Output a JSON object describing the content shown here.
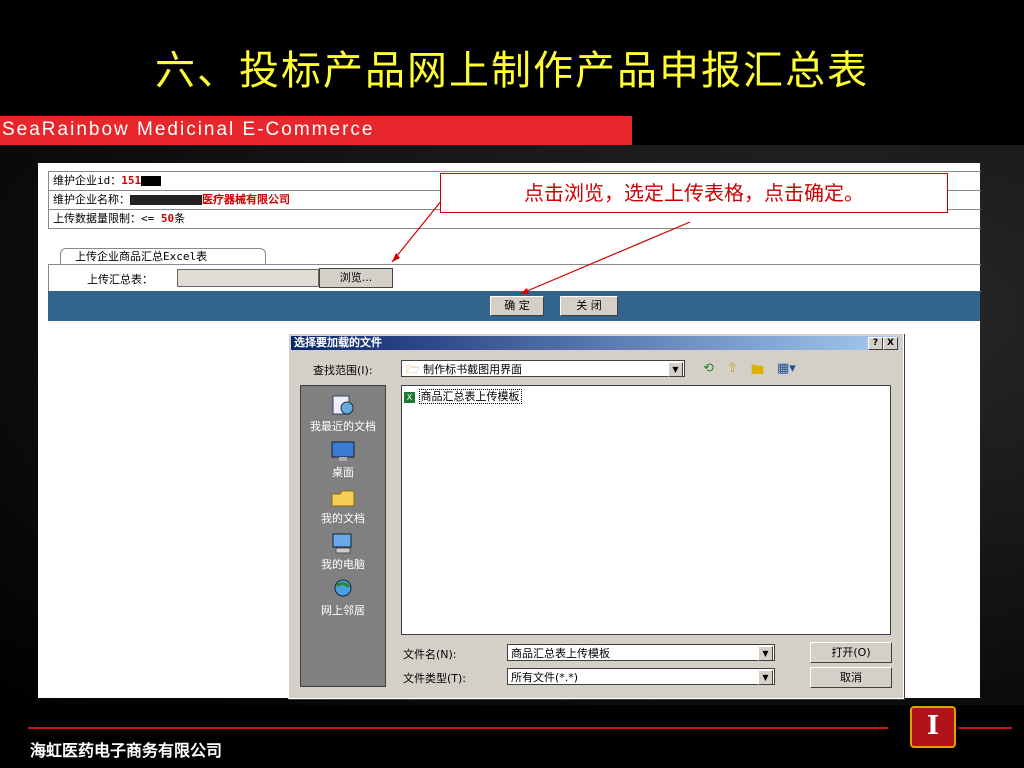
{
  "slide": {
    "title": "六、投标产品网上制作产品申报汇总表",
    "brand": "SeaRainbow Medicinal E-Commerce",
    "footer_company": "海虹医药电子商务有限公司"
  },
  "info": {
    "id_label": "维护企业id：",
    "id_value": "151",
    "name_label": "维护企业名称：",
    "name_value": "医疗器械有限公司",
    "limit_label": "上传数据量限制：<= ",
    "limit_value": "50",
    "limit_unit": "条"
  },
  "upload": {
    "tab_label": "上传企业商品汇总Excel表",
    "field_label": "上传汇总表：",
    "file_value": "",
    "browse_label": "浏览..."
  },
  "actions": {
    "confirm_label": "确 定",
    "close_label": "关 闭"
  },
  "callout": {
    "text": "点击浏览，选定上传表格，点击确定。"
  },
  "dialog": {
    "title": "选择要加载的文件",
    "help": "?",
    "close": "X",
    "lookin_label": "查找范围(I):",
    "lookin_value": "制作标书截图用界面",
    "places": [
      {
        "label": "我最近的文档",
        "icon": "recent-docs-icon"
      },
      {
        "label": "桌面",
        "icon": "desktop-icon"
      },
      {
        "label": "我的文档",
        "icon": "my-documents-icon"
      },
      {
        "label": "我的电脑",
        "icon": "my-computer-icon"
      },
      {
        "label": "网上邻居",
        "icon": "network-icon"
      }
    ],
    "files": [
      {
        "name": "商品汇总表上传模板",
        "icon": "excel-file-icon"
      }
    ],
    "filename_label": "文件名(N):",
    "filename_value": "商品汇总表上传模板",
    "filetype_label": "文件类型(T):",
    "filetype_value": "所有文件(*.*)",
    "open_label": "打开(O)",
    "cancel_label": "取消"
  }
}
